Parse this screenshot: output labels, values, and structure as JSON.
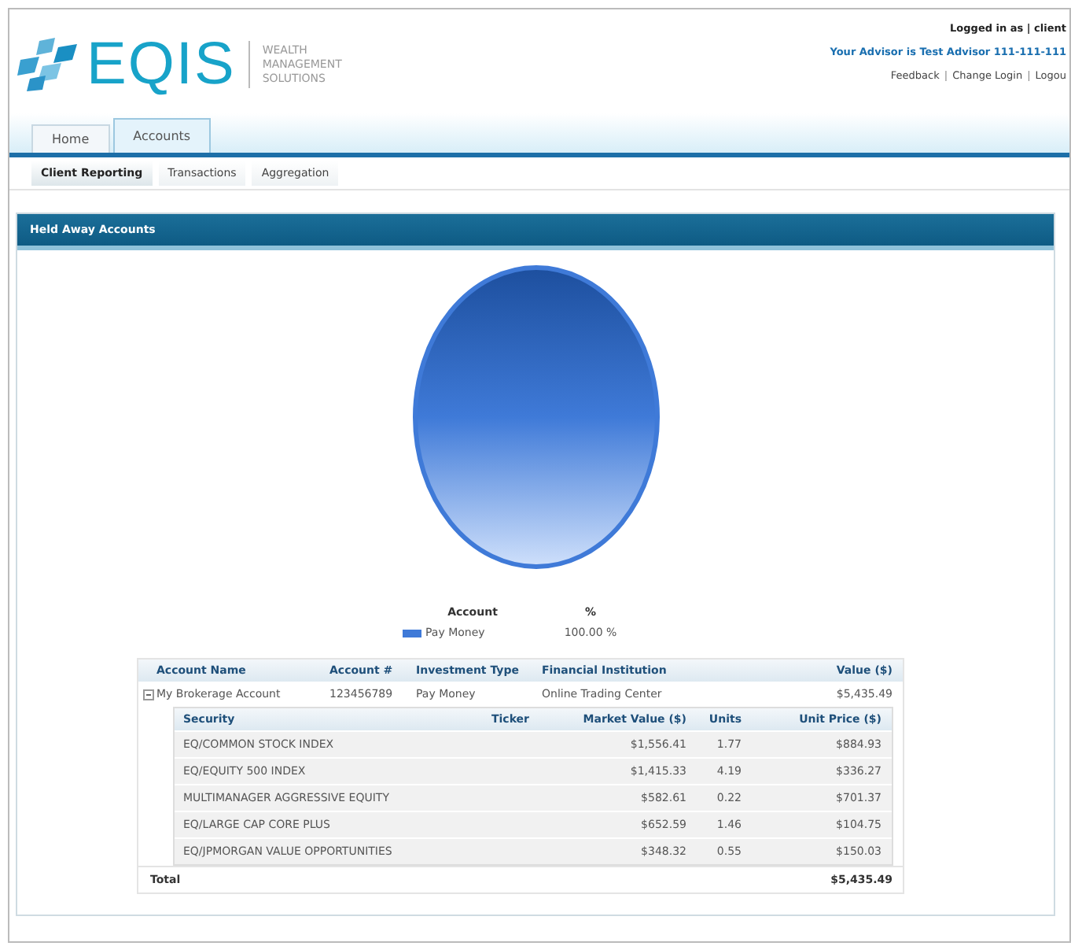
{
  "header": {
    "logo_text": "EQIS",
    "tagline": [
      "WEALTH",
      "MANAGEMENT",
      "SOLUTIONS"
    ],
    "login": "Logged in as | client",
    "advisor": "Your Advisor is Test Advisor 111-111-111",
    "links": [
      "Feedback",
      "Change Login",
      "Logou"
    ],
    "link_separator": "|"
  },
  "tabs": [
    {
      "label": "Home",
      "selected": false
    },
    {
      "label": "Accounts",
      "selected": true
    }
  ],
  "subtabs": [
    {
      "label": "Client Reporting",
      "selected": true
    },
    {
      "label": "Transactions",
      "selected": false
    },
    {
      "label": "Aggregation",
      "selected": false
    }
  ],
  "panel": {
    "title": "Held Away Accounts",
    "legend": {
      "columns": [
        "Account",
        "%"
      ],
      "items": [
        {
          "label": "Pay Money",
          "value": "100.00 %",
          "color": "#3f7ad8"
        }
      ]
    },
    "table": {
      "columns": [
        "Account Name",
        "Account #",
        "Investment Type",
        "Financial Institution",
        "Value ($)"
      ],
      "rows": [
        {
          "cells": [
            "My Brokerage Account",
            "123456789",
            "Pay Money",
            "Online Trading Center",
            "$5,435.49"
          ],
          "expanded": true,
          "holdings": {
            "columns": [
              "Security",
              "Ticker",
              "Market Value ($)",
              "Units",
              "Unit Price ($)"
            ],
            "rows": [
              [
                "EQ/COMMON STOCK INDEX",
                "",
                "$1,556.41",
                "1.77",
                "$884.93"
              ],
              [
                "EQ/EQUITY 500 INDEX",
                "",
                "$1,415.33",
                "4.19",
                "$336.27"
              ],
              [
                "MULTIMANAGER AGGRESSIVE EQUITY",
                "",
                "$582.61",
                "0.22",
                "$701.37"
              ],
              [
                "EQ/LARGE CAP CORE PLUS",
                "",
                "$652.59",
                "1.46",
                "$104.75"
              ],
              [
                "EQ/JPMORGAN VALUE OPPORTUNITIES",
                "",
                "$348.32",
                "0.55",
                "$150.03"
              ]
            ]
          }
        }
      ],
      "total": {
        "label": "Total",
        "value": "$5,435.49"
      }
    }
  }
}
